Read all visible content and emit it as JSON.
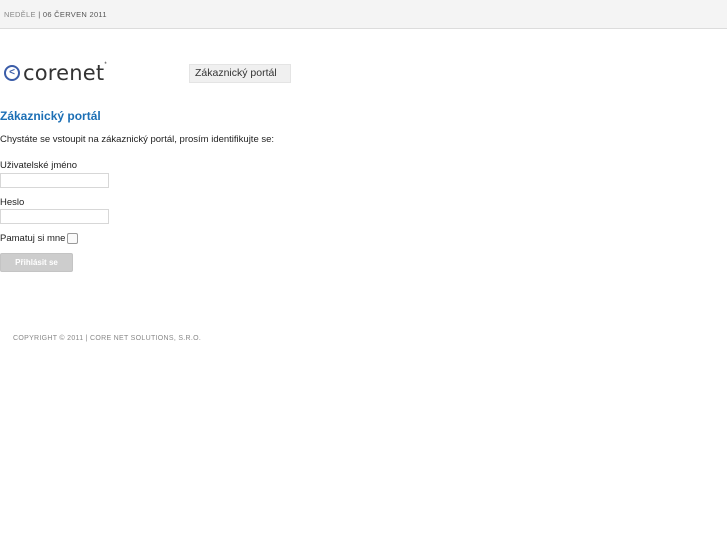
{
  "header": {
    "day": "NEDĚLE",
    "separator": "|",
    "date": "06 ČERVEN 2011"
  },
  "logo": {
    "text": "corenet",
    "mark": "<",
    "trademark": "*"
  },
  "nav": {
    "portal_tab": "Zákaznický portál"
  },
  "main": {
    "title": "Zákaznický portál",
    "intro": "Chystáte se vstoupit na zákaznický portál, prosím identifikujte se:",
    "username_label": "Uživatelské jméno",
    "username_value": "",
    "password_label": "Heslo",
    "password_value": "",
    "remember_label": "Pamatuj si mne",
    "remember_checked": false,
    "login_button": "Přihlásit se"
  },
  "footer": {
    "text": "COPYRIGHT © 2011 | CORE NET SOLUTIONS, S.R.O."
  },
  "colors": {
    "accent": "#1c6fb5",
    "logo_blue": "#3a5ca8",
    "button_bg": "#cdcdcd"
  }
}
